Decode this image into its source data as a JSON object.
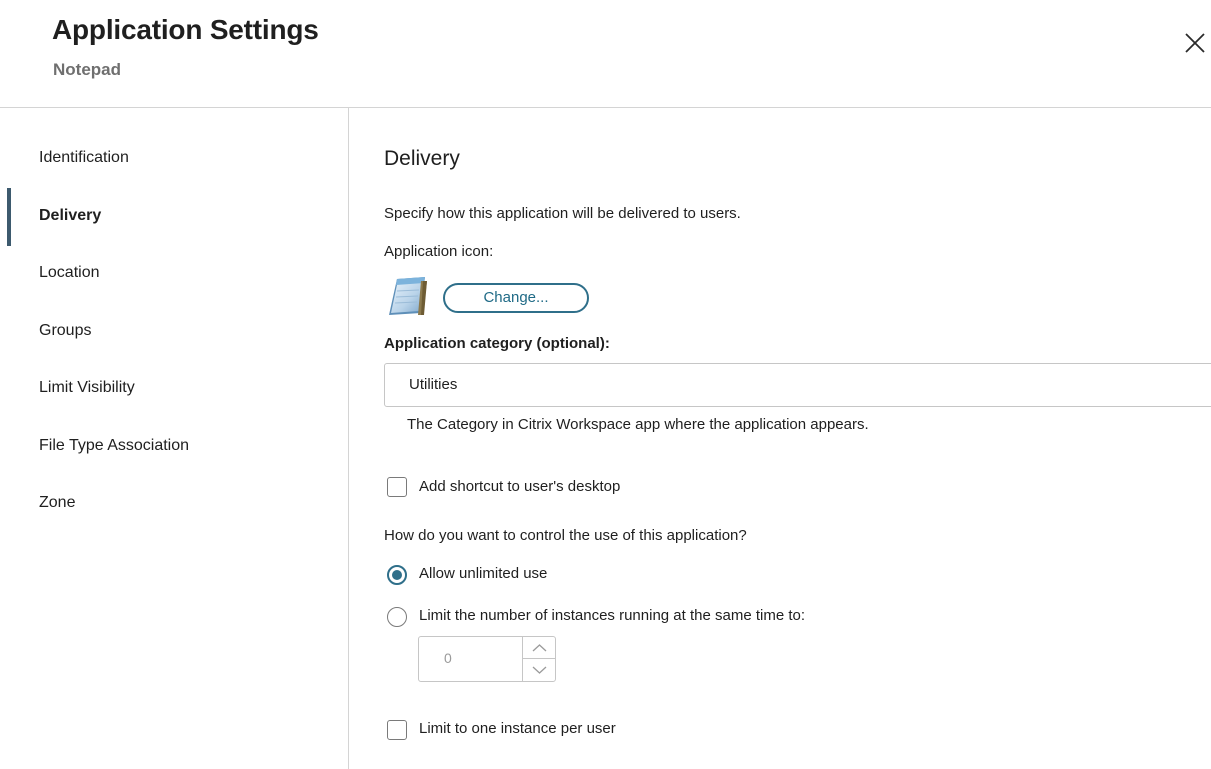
{
  "header": {
    "title": "Application Settings",
    "subtitle": "Notepad",
    "close_icon": "close-icon"
  },
  "sidebar": {
    "items": [
      {
        "label": "Identification",
        "active": false
      },
      {
        "label": "Delivery",
        "active": true
      },
      {
        "label": "Location",
        "active": false
      },
      {
        "label": "Groups",
        "active": false
      },
      {
        "label": "Limit Visibility",
        "active": false
      },
      {
        "label": "File Type Association",
        "active": false
      },
      {
        "label": "Zone",
        "active": false
      }
    ]
  },
  "main": {
    "section_title": "Delivery",
    "description": "Specify how this application will be delivered to users.",
    "icon_label": "Application icon:",
    "app_icon": "notepad-icon",
    "change_button": "Change...",
    "category_label": "Application category (optional):",
    "category_value": "Utilities",
    "category_help": "The Category in Citrix Workspace app where the application appears.",
    "shortcut_label": "Add shortcut to user's desktop",
    "shortcut_checked": false,
    "control_question": "How do you want to control the use of this application?",
    "radio_unlimited": "Allow unlimited use",
    "radio_limit": "Limit the number of instances running at the same time to:",
    "selected_option": "unlimited",
    "instances_value": "0",
    "one_instance_label": "Limit to one instance per user",
    "one_instance_checked": false
  },
  "colors": {
    "accent": "#2f6f8a",
    "nav_indicator": "#3d5a6e",
    "border": "#d4d4d4"
  }
}
